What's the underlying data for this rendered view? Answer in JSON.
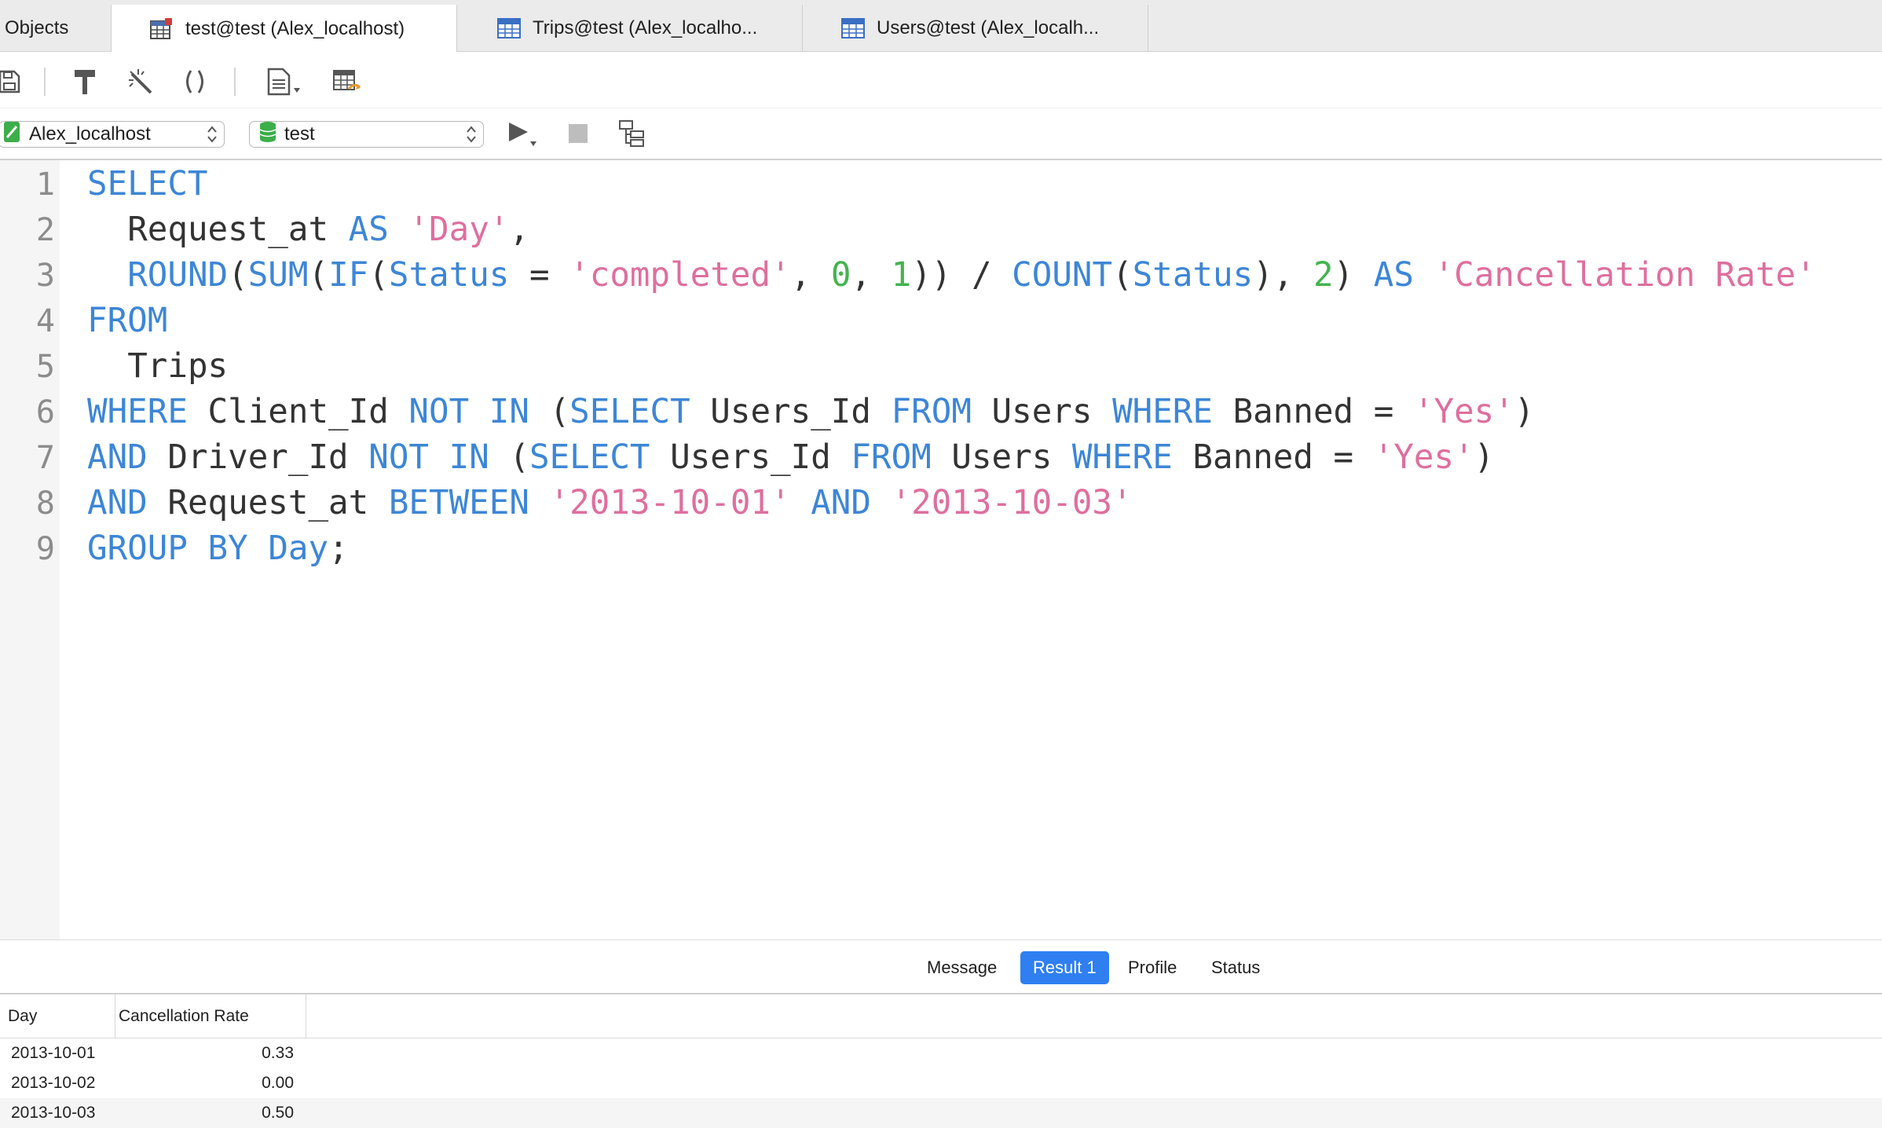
{
  "tabs": [
    {
      "label": "Objects",
      "icon": "none",
      "active": false
    },
    {
      "label": "test@test (Alex_localhost)",
      "icon": "query-icon",
      "active": true
    },
    {
      "label": "Trips@test (Alex_localho...",
      "icon": "table-icon",
      "active": false
    },
    {
      "label": "Users@test (Alex_localh...",
      "icon": "table-icon",
      "active": false
    }
  ],
  "toolbar": {
    "buttons": [
      "save-icon",
      "format-brush-icon",
      "beautify-wand-icon",
      "parentheses-icon",
      "snippet-document-icon",
      "export-table-icon"
    ]
  },
  "connection": {
    "connection_name": "Alex_localhost",
    "database_name": "test"
  },
  "editor": {
    "line_numbers": [
      "1",
      "2",
      "3",
      "4",
      "5",
      "6",
      "7",
      "8",
      "9"
    ],
    "lines": [
      "SELECT",
      "  Request_at AS 'Day',",
      "  ROUND(SUM(IF(Status = 'completed', 0, 1)) / COUNT(Status), 2) AS 'Cancellation Rate'",
      "FROM",
      "  Trips",
      "WHERE Client_Id NOT IN (SELECT Users_Id FROM Users WHERE Banned = 'Yes')",
      "AND Driver_Id NOT IN (SELECT Users_Id FROM Users WHERE Banned = 'Yes')",
      "AND Request_at BETWEEN '2013-10-01' AND '2013-10-03'",
      "GROUP BY Day;"
    ]
  },
  "result_tabs": {
    "message": "Message",
    "result1": "Result 1",
    "profile": "Profile",
    "status": "Status",
    "active": "Result 1"
  },
  "results": {
    "columns": [
      "Day",
      "Cancellation Rate"
    ],
    "rows": [
      [
        "2013-10-01",
        "0.33"
      ],
      [
        "2013-10-02",
        "0.00"
      ],
      [
        "2013-10-03",
        "0.50"
      ]
    ]
  },
  "colors": {
    "keyword": "#3d86d6",
    "string": "#de6f9e",
    "number": "#44b34f",
    "identifier": "#333333",
    "active_tab_accent": "#2f7ff0"
  }
}
